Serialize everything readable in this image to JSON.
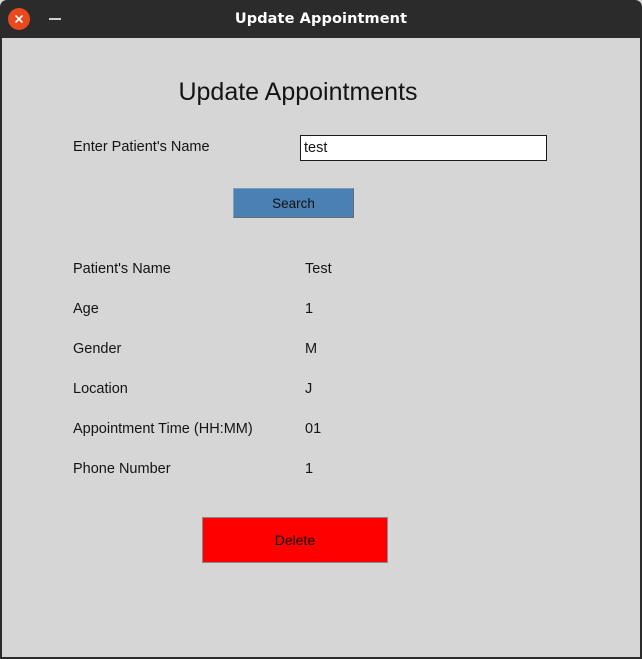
{
  "window": {
    "title": "Update Appointment",
    "close_icon": "close-x-icon",
    "minimize_icon": "minimize-dash-icon",
    "titlebar_color": "#2b2b2b",
    "background_color": "#d6d6d6"
  },
  "heading": "Update Appointments",
  "form": {
    "name_label": "Enter Patient's Name",
    "name_value": "test",
    "name_placeholder": "",
    "search_label": "Search",
    "search_color": "#4a81b4"
  },
  "records": [
    {
      "label": "Patient's Name",
      "value": "Test"
    },
    {
      "label": "Age",
      "value": "1"
    },
    {
      "label": "Gender",
      "value": "M"
    },
    {
      "label": "Location",
      "value": "J"
    },
    {
      "label": "Appointment Time (HH:MM)",
      "value": "01"
    },
    {
      "label": "Phone Number",
      "value": "1"
    }
  ],
  "actions": {
    "delete_label": "Delete",
    "delete_color": "#fe0000"
  }
}
